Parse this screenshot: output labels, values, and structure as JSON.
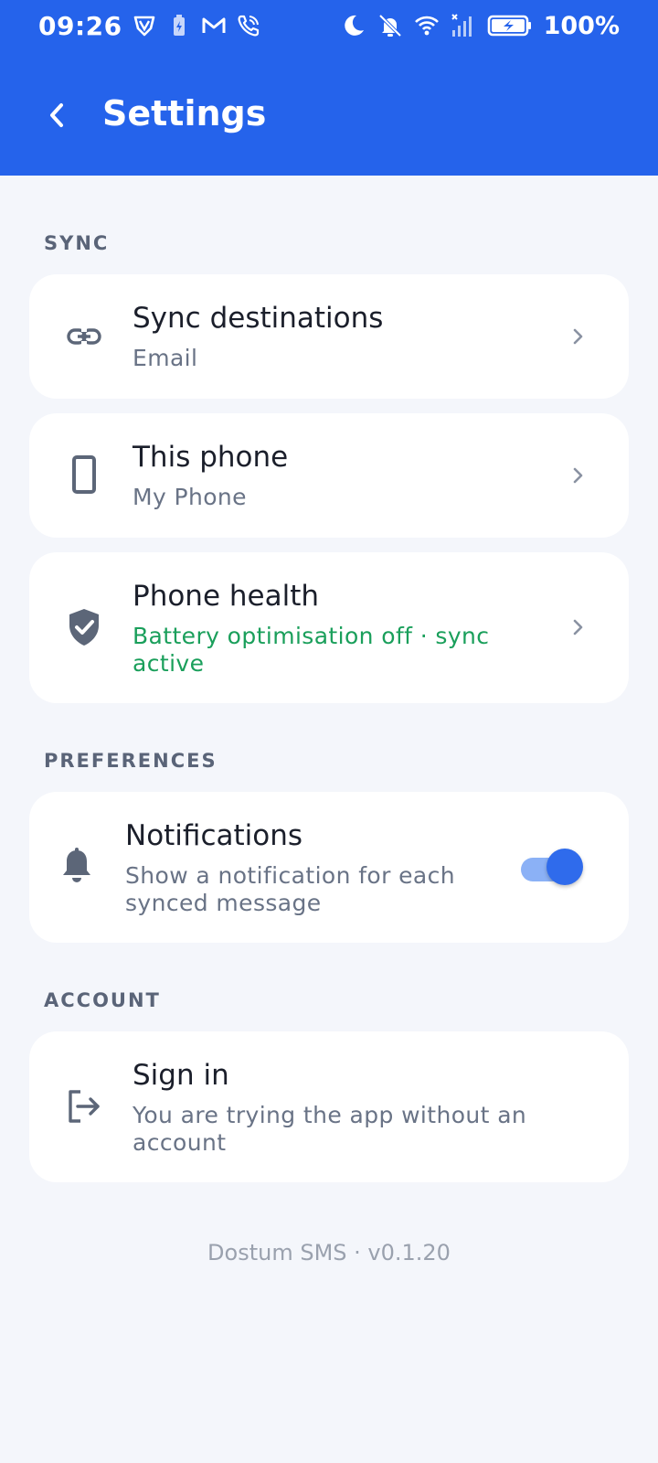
{
  "status_bar": {
    "time": "09:26",
    "battery_percent": "100%",
    "icons_left": [
      "vpn-shield-icon",
      "battery-saver-icon",
      "gmail-icon",
      "wifi-calling-icon"
    ],
    "icons_right": [
      "moon-icon",
      "bell-off-icon",
      "wifi-icon",
      "signal-icon",
      "battery-icon"
    ]
  },
  "header": {
    "title": "Settings",
    "back_icon": "chevron-left-icon"
  },
  "colors": {
    "accent": "#2563eb",
    "status_green": "#1a9f5b",
    "background": "#f4f6fb"
  },
  "sections": {
    "sync": {
      "label": "SYNC",
      "items": [
        {
          "icon": "link-icon",
          "title": "Sync destinations",
          "subtitle": "Email"
        },
        {
          "icon": "phone-icon",
          "title": "This phone",
          "subtitle": "My Phone"
        },
        {
          "icon": "shield-check-icon",
          "title": "Phone health",
          "subtitle": "Battery optimisation off · sync active"
        }
      ]
    },
    "preferences": {
      "label": "PREFERENCES",
      "items": [
        {
          "icon": "bell-icon",
          "title": "Notifications",
          "subtitle": "Show a notification for each synced message",
          "toggle_on": true
        }
      ]
    },
    "account": {
      "label": "ACCOUNT",
      "items": [
        {
          "icon": "sign-in-icon",
          "title": "Sign in",
          "subtitle": "You are trying the app without an account"
        }
      ]
    }
  },
  "footer": {
    "text": "Dostum SMS · v0.1.20"
  }
}
